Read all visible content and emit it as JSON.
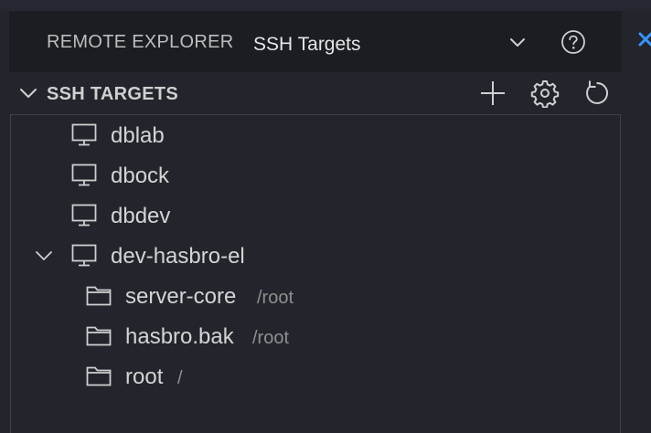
{
  "header": {
    "title": "REMOTE EXPLORER",
    "dropdown_value": "SSH Targets"
  },
  "section": {
    "title": "SSH TARGETS"
  },
  "tree": {
    "hosts": [
      {
        "label": "dblab"
      },
      {
        "label": "dbock"
      },
      {
        "label": "dbdev"
      },
      {
        "label": "dev-hasbro-el",
        "expanded": true,
        "folders": [
          {
            "label": "server-core",
            "path": "/root"
          },
          {
            "label": "hasbro.bak",
            "path": "/root"
          },
          {
            "label": "root",
            "path": "/"
          }
        ]
      }
    ]
  },
  "icons": {
    "host": "monitor-icon",
    "folder": "folder-icon",
    "add": "plus-icon",
    "configure": "gear-icon",
    "refresh": "refresh-icon",
    "help": "help-circle-icon",
    "dropdown": "chevron-down-icon",
    "collapse": "chevron-down-icon",
    "close": "close-icon"
  },
  "colors": {
    "background": "#22252c",
    "header_background": "#1b1d22",
    "text": "#d4d4d4",
    "description": "#8f8f8f",
    "close_accent": "#3794ff"
  }
}
